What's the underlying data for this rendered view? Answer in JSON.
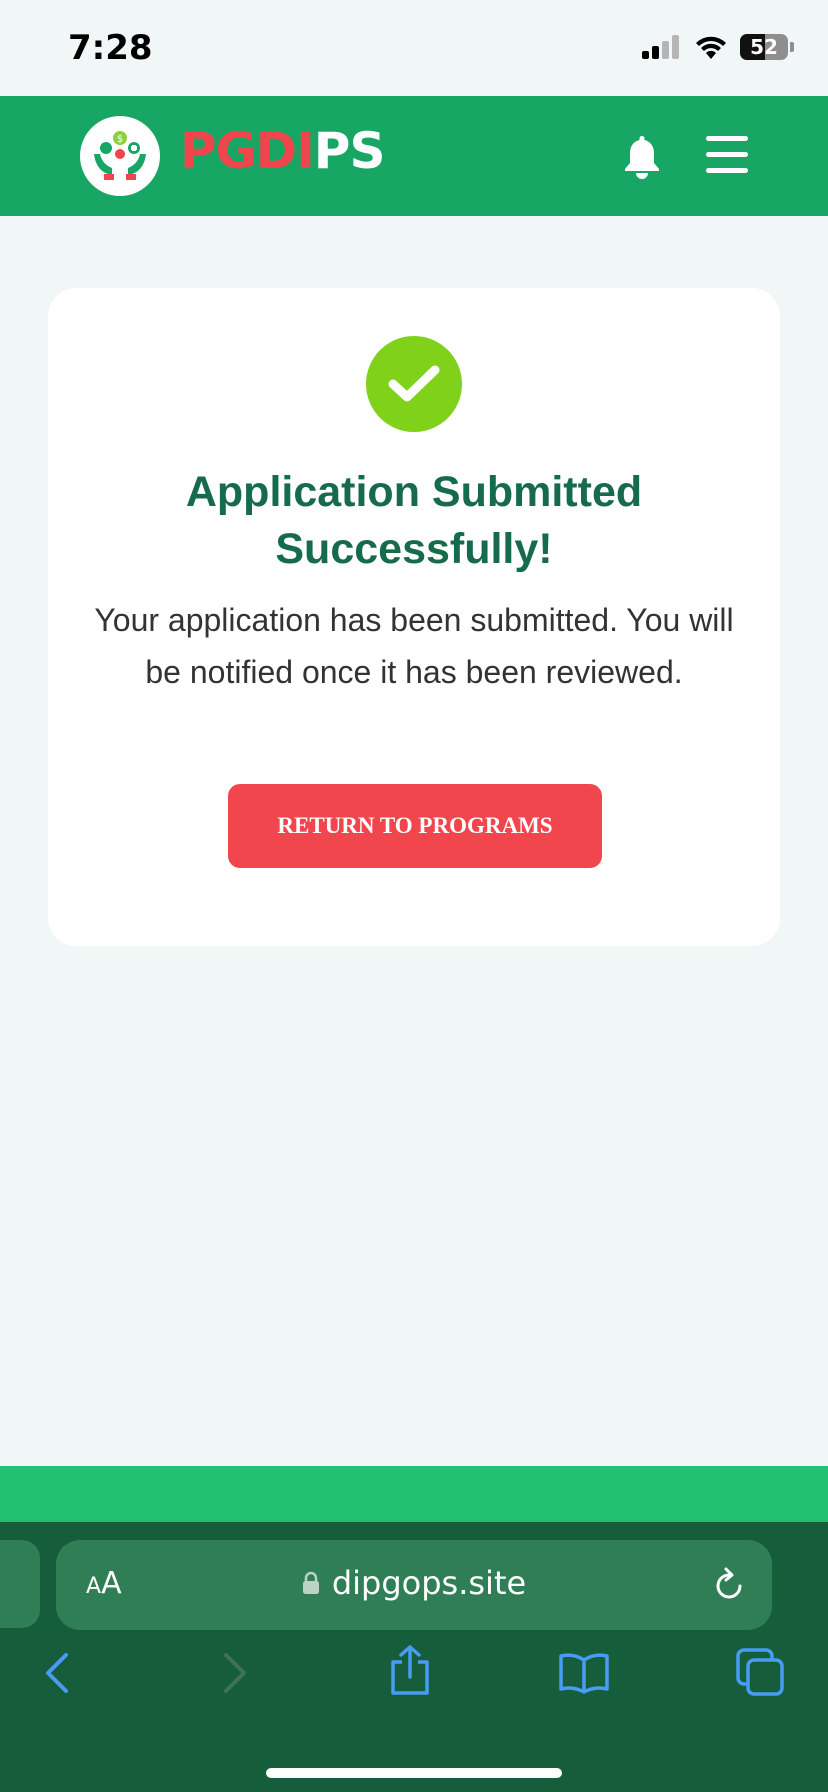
{
  "status_bar": {
    "time": "7:28",
    "battery": "52"
  },
  "header": {
    "brand_part_red": "PGDI",
    "brand_part_white": "PS"
  },
  "card": {
    "title": "Application Submitted Successfully!",
    "message": "Your application has been submitted. You will be notified once it has been reviewed.",
    "button_label": "RETURN TO PROGRAMS"
  },
  "browser": {
    "aa_small": "A",
    "aa_large": "A",
    "url": "dipgops.site"
  },
  "colors": {
    "header_green": "#17a664",
    "brand_red": "#f0454c",
    "title_green": "#166b4c",
    "check_green": "#7fd11a",
    "button_red": "#f2464e",
    "browser_green": "#155d3b"
  }
}
